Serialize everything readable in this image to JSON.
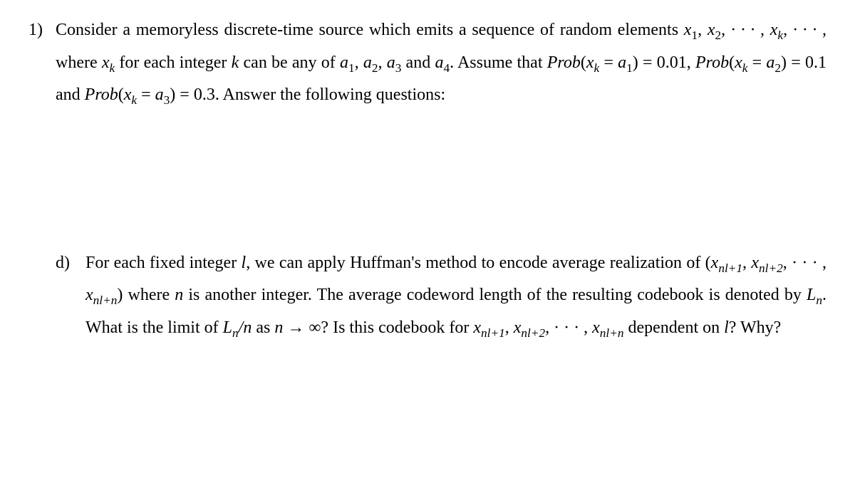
{
  "problem": {
    "number": "1)",
    "intro_part1": "Consider a memoryless discrete-time source which emits a sequence of random elements ",
    "seq1": "x",
    "seq1_sub": "1",
    "comma": ", ",
    "seq2": "x",
    "seq2_sub": "2",
    "dots": ", · · · , ",
    "seqk": "x",
    "seqk_sub": "k",
    "dots2": ", · · · ,",
    "where": " where ",
    "xk": "x",
    "xk_sub": "k",
    "intro_part2": " for each integer ",
    "k": "k",
    "intro_part3": " can be any of ",
    "a1": "a",
    "a1_sub": "1",
    "a2": "a",
    "a2_sub": "2",
    "a3": "a",
    "a3_sub": "3",
    "and": " and ",
    "a4": "a",
    "a4_sub": "4",
    "assume": ". Assume that ",
    "prob": "Prob",
    "lp": "(",
    "eq": " = ",
    "rp": ")",
    "eqv1": " = 0.01, ",
    "eqv2": " = 0.1 and ",
    "eqv3": " = 0.3. Answer the following questions:"
  },
  "subpart": {
    "label": "d)",
    "text1": "For each fixed integer ",
    "l": "l",
    "text2": ", we can apply Huffman's method to encode average realization of ",
    "lparen": "(",
    "x": "x",
    "sub_nl1": "nl+1",
    "sub_nl2": "nl+2",
    "sub_nln": "nl+n",
    "comma": ", ",
    "dots": ", · · · , ",
    "rparen": ")",
    "text3": " where ",
    "n": "n",
    "text4": " is another integer. The average codeword length of the resulting codebook is denoted by ",
    "Ln": "L",
    "Ln_sub": "n",
    "text5": ". What is the limit of ",
    "slash": "/",
    "text6": " as ",
    "arrow": " → ∞",
    "text7": "? Is this codebook for ",
    "text8": " dependent on ",
    "text9": "? Why?"
  }
}
